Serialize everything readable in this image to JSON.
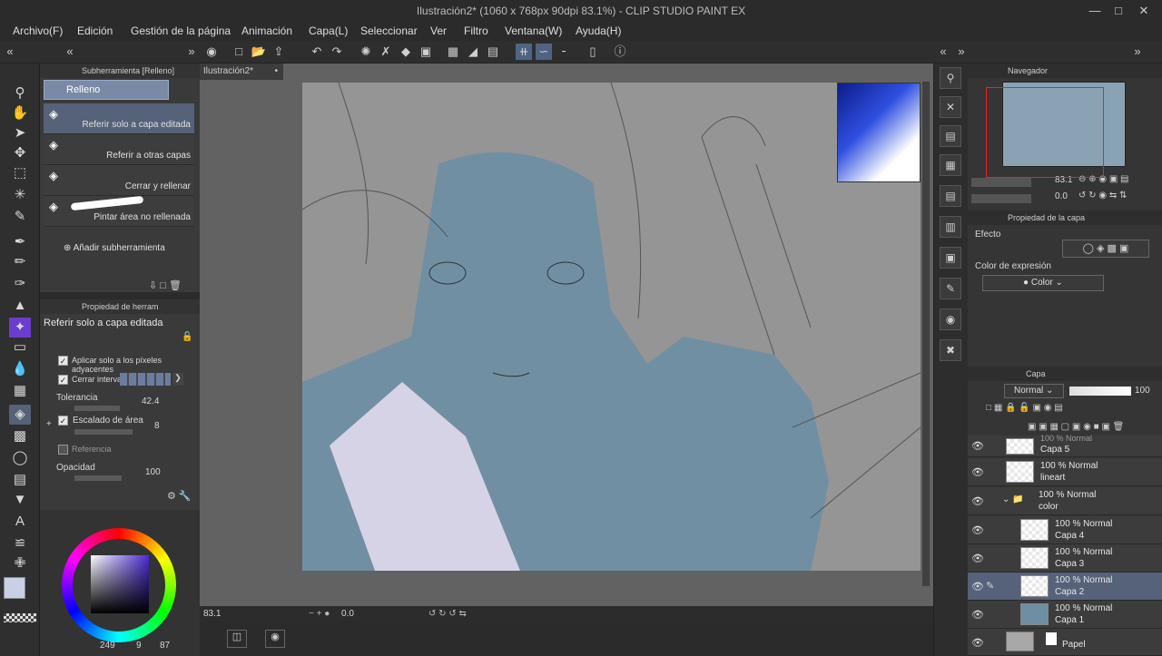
{
  "window": {
    "title": "Ilustración2* (1060 x 768px 90dpi 83.1%)  - CLIP STUDIO PAINT EX"
  },
  "menu": [
    "Archivo(F)",
    "Edición",
    "Gestión de la página",
    "Animación",
    "Capa(L)",
    "Seleccionar",
    "Ver",
    "Filtro",
    "Ventana(W)",
    "Ayuda(H)"
  ],
  "subtool": {
    "title": "Subherramienta [Relleno]",
    "group": "Relleno",
    "items": [
      "Referir solo a capa editada",
      "Referir a otras capas",
      "Cerrar y rellenar",
      "Pintar área no rellenada"
    ],
    "add": "Añadir subherramienta"
  },
  "toolprop": {
    "title": "Propiedad de herram",
    "name": "Referir solo a capa editada",
    "adjacent": "Aplicar solo a los píxeles adyacentes",
    "close_gap": "Cerrar intervalo",
    "tolerance_label": "Tolerancia",
    "tolerance": "42.4",
    "area_label": "Escalado de área",
    "area": "8",
    "reference": "Referencia",
    "opacity_label": "Opacidad",
    "opacity": "100"
  },
  "color": {
    "v1": "249",
    "v2": "9",
    "v3": "87",
    "main": "#c9cfe6"
  },
  "document": {
    "tab": "Ilustración2*"
  },
  "status": {
    "zoom": "83.1",
    "angle": "0.0"
  },
  "navigator": {
    "title": "Navegador",
    "zoom": "83.1",
    "rotation": "0.0"
  },
  "layerprop": {
    "title": "Propiedad de la capa",
    "effect": "Efecto",
    "expr_label": "Color de expresión",
    "expr": "Color"
  },
  "layers": {
    "title": "Capa",
    "blend": "Normal",
    "opacity": "100",
    "list": [
      {
        "pct": "100 % Normal",
        "name": "Capa 5"
      },
      {
        "pct": "100 % Normal",
        "name": "lineart"
      },
      {
        "pct": "100 % Normal",
        "name": "color"
      },
      {
        "pct": "100 % Normal",
        "name": "Capa 4"
      },
      {
        "pct": "100 % Normal",
        "name": "Capa 3"
      },
      {
        "pct": "100 % Normal",
        "name": "Capa 2"
      },
      {
        "pct": "100 % Normal",
        "name": "Capa 1"
      },
      {
        "pct": "",
        "name": "Papel"
      }
    ]
  }
}
